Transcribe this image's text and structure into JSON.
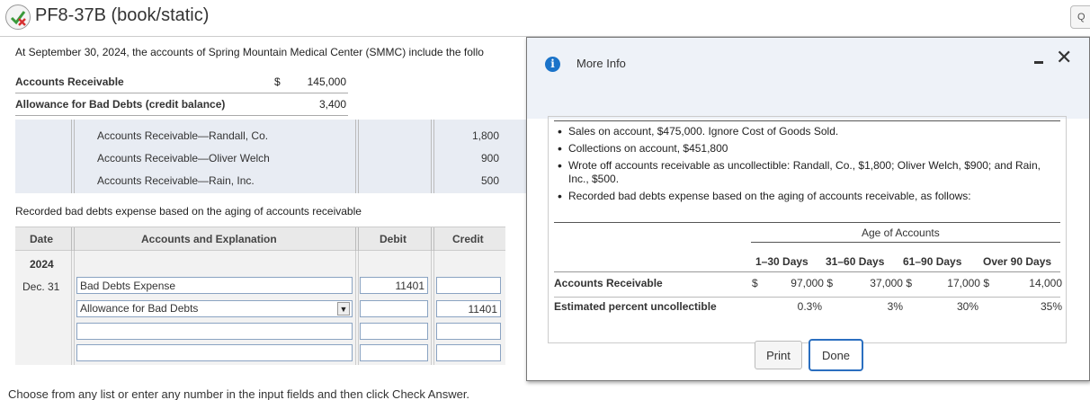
{
  "header": {
    "title": "PF8-37B (book/static)",
    "right_glyph": "Q"
  },
  "intro": "At September 30, 2024, the accounts of Spring Mountain Medical Center (SMMC) include the follo",
  "balances": [
    {
      "label": "Accounts Receivable",
      "currency": "$",
      "amount": "145,000"
    },
    {
      "label": "Allowance for Bad Debts (credit balance)",
      "currency": "",
      "amount": "3,400"
    }
  ],
  "writeoffs": [
    {
      "account": "Accounts Receivable—Randall, Co.",
      "credit": "1,800"
    },
    {
      "account": "Accounts Receivable—Oliver Welch",
      "credit": "900"
    },
    {
      "account": "Accounts Receivable—Rain, Inc.",
      "credit": "500"
    }
  ],
  "recorded_label": "Recorded bad debts expense based on the aging of accounts receivable",
  "journal": {
    "headers": {
      "date": "Date",
      "accounts": "Accounts and Explanation",
      "debit": "Debit",
      "credit": "Credit"
    },
    "year": "2024",
    "date": "Dec. 31",
    "rows": [
      {
        "account": "Bad Debts Expense",
        "debit": "11401",
        "credit": ""
      },
      {
        "account": "Allowance for Bad Debts",
        "debit": "",
        "credit": "11401"
      },
      {
        "account": "",
        "debit": "",
        "credit": ""
      },
      {
        "account": "",
        "debit": "",
        "credit": ""
      }
    ]
  },
  "footer": "Choose from any list or enter any number in the input fields and then click Check Answer.",
  "modal": {
    "title": "More Info",
    "bullets": [
      "Sales on account, $475,000. Ignore Cost of Goods Sold.",
      "Collections on account, $451,800",
      "Wrote off accounts receivable as uncollectible: Randall, Co., $1,800; Oliver Welch, $900; and Rain, Inc., $500.",
      "Recorded bad debts expense based on the aging of accounts receivable, as follows:"
    ],
    "aging": {
      "group_header": "Age of Accounts",
      "columns": [
        "1–30 Days",
        "31–60 Days",
        "61–90 Days",
        "Over 90 Days"
      ],
      "rows": [
        {
          "label": "Accounts Receivable",
          "prefix": "$",
          "values": [
            "97,000 $",
            "37,000 $",
            "17,000 $",
            "14,000"
          ]
        },
        {
          "label": "Estimated percent uncollectible",
          "prefix": "",
          "values": [
            "0.3%",
            "3%",
            "30%",
            "35%"
          ]
        }
      ]
    },
    "print_label": "Print",
    "done_label": "Done"
  },
  "colors": {
    "accent": "#2b6fc0",
    "info_icon": "#1a73c9",
    "panel": "#e8ecf3"
  }
}
